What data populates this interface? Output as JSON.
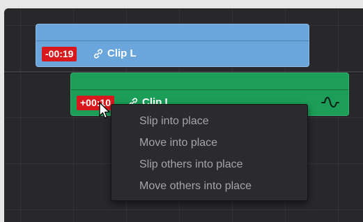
{
  "clips": {
    "upper": {
      "timecode": "-00:19",
      "name": "Clip L",
      "color": "#6aa6dc",
      "link_icon": "link-icon"
    },
    "lower": {
      "timecode": "+00:10",
      "name": "Clip L",
      "color": "#1c9e58",
      "link_icon": "link-icon",
      "audio_icon": "waveform-icon"
    }
  },
  "timecode_color": "#d8181c",
  "context_menu": {
    "items": [
      "Slip into place",
      "Move into place",
      "Slip others into place",
      "Move others into place"
    ]
  },
  "cursor": "arrow-pointer-icon"
}
